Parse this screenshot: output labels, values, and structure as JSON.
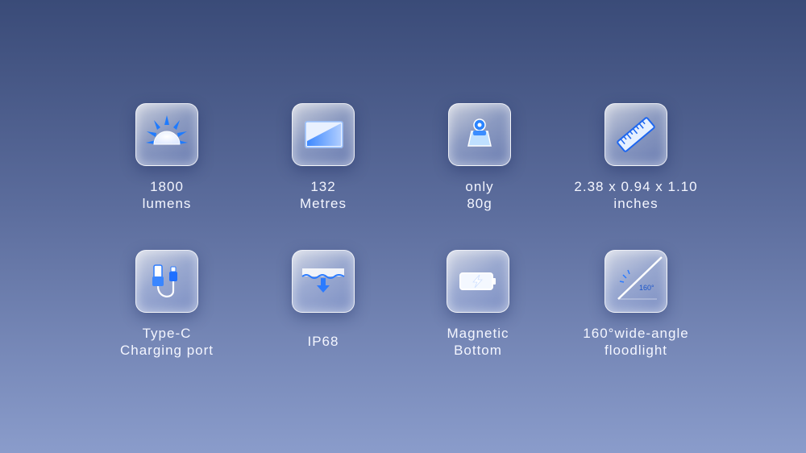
{
  "features": [
    {
      "lines": [
        "1800",
        "lumens"
      ],
      "icon": "sun-brightness-icon"
    },
    {
      "lines": [
        "132",
        "Metres"
      ],
      "icon": "beam-distance-icon"
    },
    {
      "lines": [
        "only",
        "80g"
      ],
      "icon": "weight-icon"
    },
    {
      "lines": [
        "2.38 x 0.94 x 1.10",
        "inches"
      ],
      "icon": "ruler-icon"
    },
    {
      "lines": [
        "Type-C",
        "Charging port"
      ],
      "icon": "usb-c-cable-icon"
    },
    {
      "lines": [
        "IP68"
      ],
      "icon": "waterproof-icon"
    },
    {
      "lines": [
        "Magnetic",
        "Bottom"
      ],
      "icon": "magnetic-battery-icon"
    },
    {
      "lines": [
        "160°wide-angle",
        "floodlight"
      ],
      "icon": "wide-angle-icon",
      "icon_text": "160°"
    }
  ],
  "colors": {
    "accent": "#1b6dff",
    "bg_top": "#3a4b78",
    "bg_bottom": "#8a9ccb"
  }
}
